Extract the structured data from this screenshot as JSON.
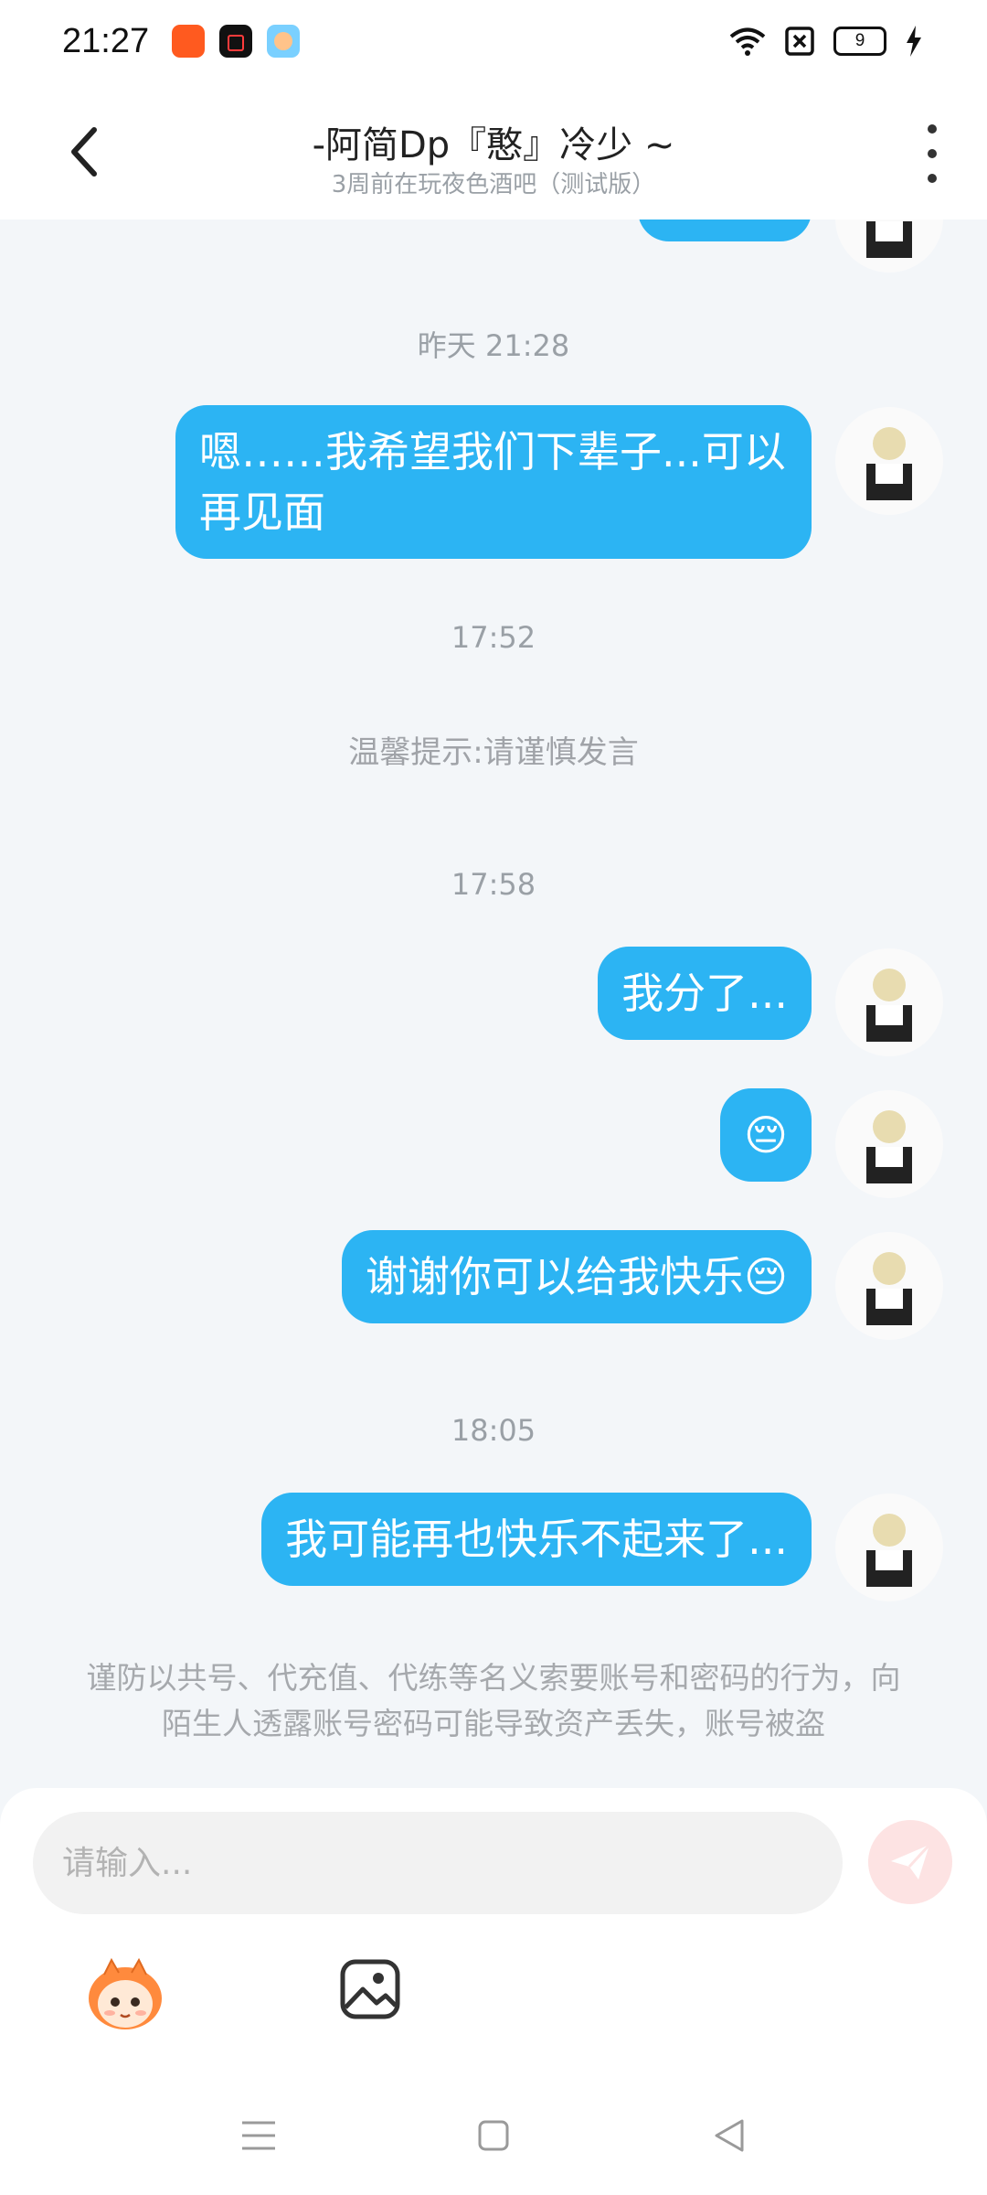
{
  "status_bar": {
    "time": "21:27",
    "apps": [
      {
        "icon": "kuaishou-icon",
        "color": "#ff5a1f"
      },
      {
        "icon": "video-record-icon",
        "color": "#111111"
      },
      {
        "icon": "game-app-icon",
        "color": "#7ad0ff"
      }
    ],
    "battery_level": "9",
    "icons": [
      "wifi-icon",
      "sim-off-icon",
      "battery-icon",
      "charging-icon"
    ]
  },
  "header": {
    "title": "-阿简Dp『憨』冷少 ~",
    "subtitle": "3周前在玩夜色酒吧（测试版）",
    "back_icon": "chevron-left-icon",
    "more_icon": "more-vertical-icon"
  },
  "chat": {
    "timestamps": [
      "昨天 21:28",
      "17:52",
      "17:58",
      "18:05"
    ],
    "system_notice": "温馨提示:请谨慎发言",
    "messages": [
      {
        "text": "嗯……我希望我们下辈子...可以再见面",
        "sender": "self"
      },
      {
        "text": "我分了...",
        "sender": "self"
      },
      {
        "text": "😔",
        "sender": "self"
      },
      {
        "text": "谢谢你可以给我快乐😔",
        "sender": "self"
      },
      {
        "text": "我可能再也快乐不起来了...",
        "sender": "self"
      }
    ],
    "warning": "谨防以共号、代充值、代练等名义索要账号和密码的行为，向陌生人透露账号密码可能导致资产丢失，账号被盗",
    "bubble_color": "#2cb4f3"
  },
  "composer": {
    "placeholder": "请输入...",
    "send_icon": "paper-plane-icon",
    "tools": [
      "mascot-emoji-icon",
      "image-icon"
    ]
  },
  "navbar": {
    "icons": [
      "menu-icon",
      "home-square-icon",
      "back-triangle-icon"
    ]
  }
}
